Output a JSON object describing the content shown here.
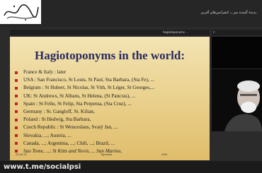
{
  "window": {
    "meeting_title": "پدیدهٔ گمنده میز ــ کنفرانس‌های آفرین",
    "share_label": "hagiotoponyms ...",
    "video_label": "۳۰"
  },
  "slide": {
    "title": "Hagiotoponyms in the world:",
    "bullets": [
      "France & Italy : later",
      "USA : San Francisco, St Louis, St Paul, Sta Barbara, (Sta Fe), ...",
      "Belgium : St Hubert, St Nicolas, St Vith, St Léger, St Georges,...",
      "UK: St Andrews, St Albans, St Helena, (St Pancras), ...",
      "Spain : St Feliu, St Felip, Sta Perpetua, (Sta Cruz), ...",
      "Germany : St. Gangloff, St. Kilian,",
      "Poland : St Hedwig, Sta Barbara,",
      "Czech Republic : St Wenceslaus, Svatý Jan, ...",
      "Slovakia, ...; Austria, ...",
      "Canada, ...; Argentina, ...; Chili, ...; Brazil, ...",
      "Sao Tome, ...; St Kitts and Nevis, ... San Marino,"
    ],
    "date": "23-03-21",
    "center": "Toponms",
    "page": "4/99"
  },
  "footer": {
    "url": "www.t.me/socialpsi"
  }
}
